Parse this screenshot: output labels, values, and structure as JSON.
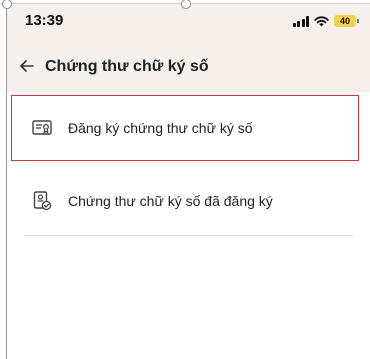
{
  "status_bar": {
    "time": "13:39",
    "battery": "40"
  },
  "header": {
    "title": "Chứng thư chữ ký số"
  },
  "menu": {
    "items": [
      {
        "label": "Đăng ký chứng thư chữ ký số",
        "icon": "certificate-icon",
        "highlighted": true
      },
      {
        "label": "Chứng thư chữ ký số đã đăng ký",
        "icon": "registered-certificate-icon",
        "highlighted": false
      }
    ]
  },
  "colors": {
    "header_bg": "#f5f0eb",
    "highlight_border": "#d13a3a",
    "battery": "#f3d24a"
  }
}
